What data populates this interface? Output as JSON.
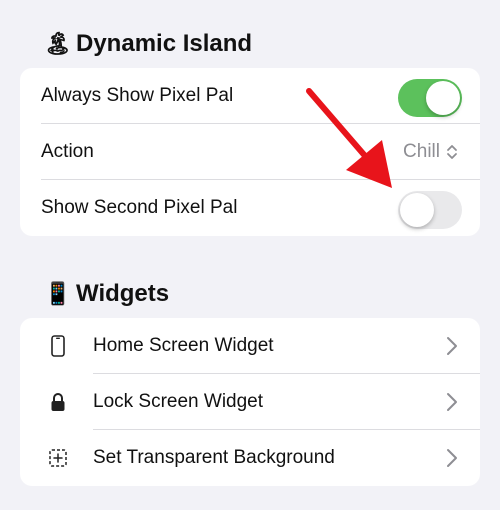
{
  "sections": {
    "dynamic_island": {
      "emoji": "🏝",
      "title": "Dynamic Island",
      "rows": {
        "always_show": {
          "label": "Always Show Pixel Pal",
          "toggle_on": true
        },
        "action": {
          "label": "Action",
          "value": "Chill"
        },
        "second_pal": {
          "label": "Show Second Pixel Pal",
          "toggle_on": false
        }
      }
    },
    "widgets": {
      "emoji": "📱",
      "title": "Widgets",
      "rows": {
        "home": {
          "label": "Home Screen Widget",
          "icon": "iphone-icon"
        },
        "lock": {
          "label": "Lock Screen Widget",
          "icon": "lock-icon"
        },
        "transparent": {
          "label": "Set Transparent Background",
          "icon": "dashed-plus-square-icon"
        }
      }
    }
  },
  "colors": {
    "background": "#f2f2f7",
    "toggle_on": "#5cc15c",
    "toggle_off": "#e9e9eb",
    "annotation_arrow": "#e8141b"
  }
}
